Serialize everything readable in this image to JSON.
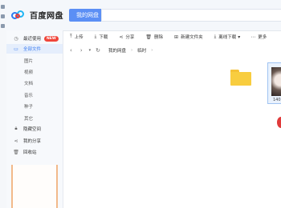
{
  "app": {
    "name": "百度网盘",
    "top_tab": "我的网盘"
  },
  "sidebar": {
    "recent": {
      "label": "最近使用",
      "badge": "NEW",
      "icon": "clock-icon"
    },
    "all_files": {
      "label": "全部文件",
      "icon": "file-icon"
    },
    "categories": [
      "图片",
      "视频",
      "文档",
      "音乐",
      "种子",
      "其它"
    ],
    "hidden": {
      "label": "隐藏空间",
      "icon": "lock-icon"
    },
    "share": {
      "label": "我的分享",
      "icon": "share-icon"
    },
    "trash": {
      "label": "回收站",
      "icon": "trash-icon"
    }
  },
  "toolbar": {
    "upload": "上传",
    "download": "下载",
    "share": "分享",
    "delete": "删除",
    "new_folder": "新建文件夹",
    "offline_download": "离线下载",
    "more": "更多"
  },
  "path": {
    "crumbs": [
      "我的网盘",
      "临时"
    ]
  },
  "files": {
    "thumb_label": "140"
  },
  "colors": {
    "accent": "#5b8ff5",
    "folder": "#f8cd3f",
    "badge": "#f0453a"
  }
}
